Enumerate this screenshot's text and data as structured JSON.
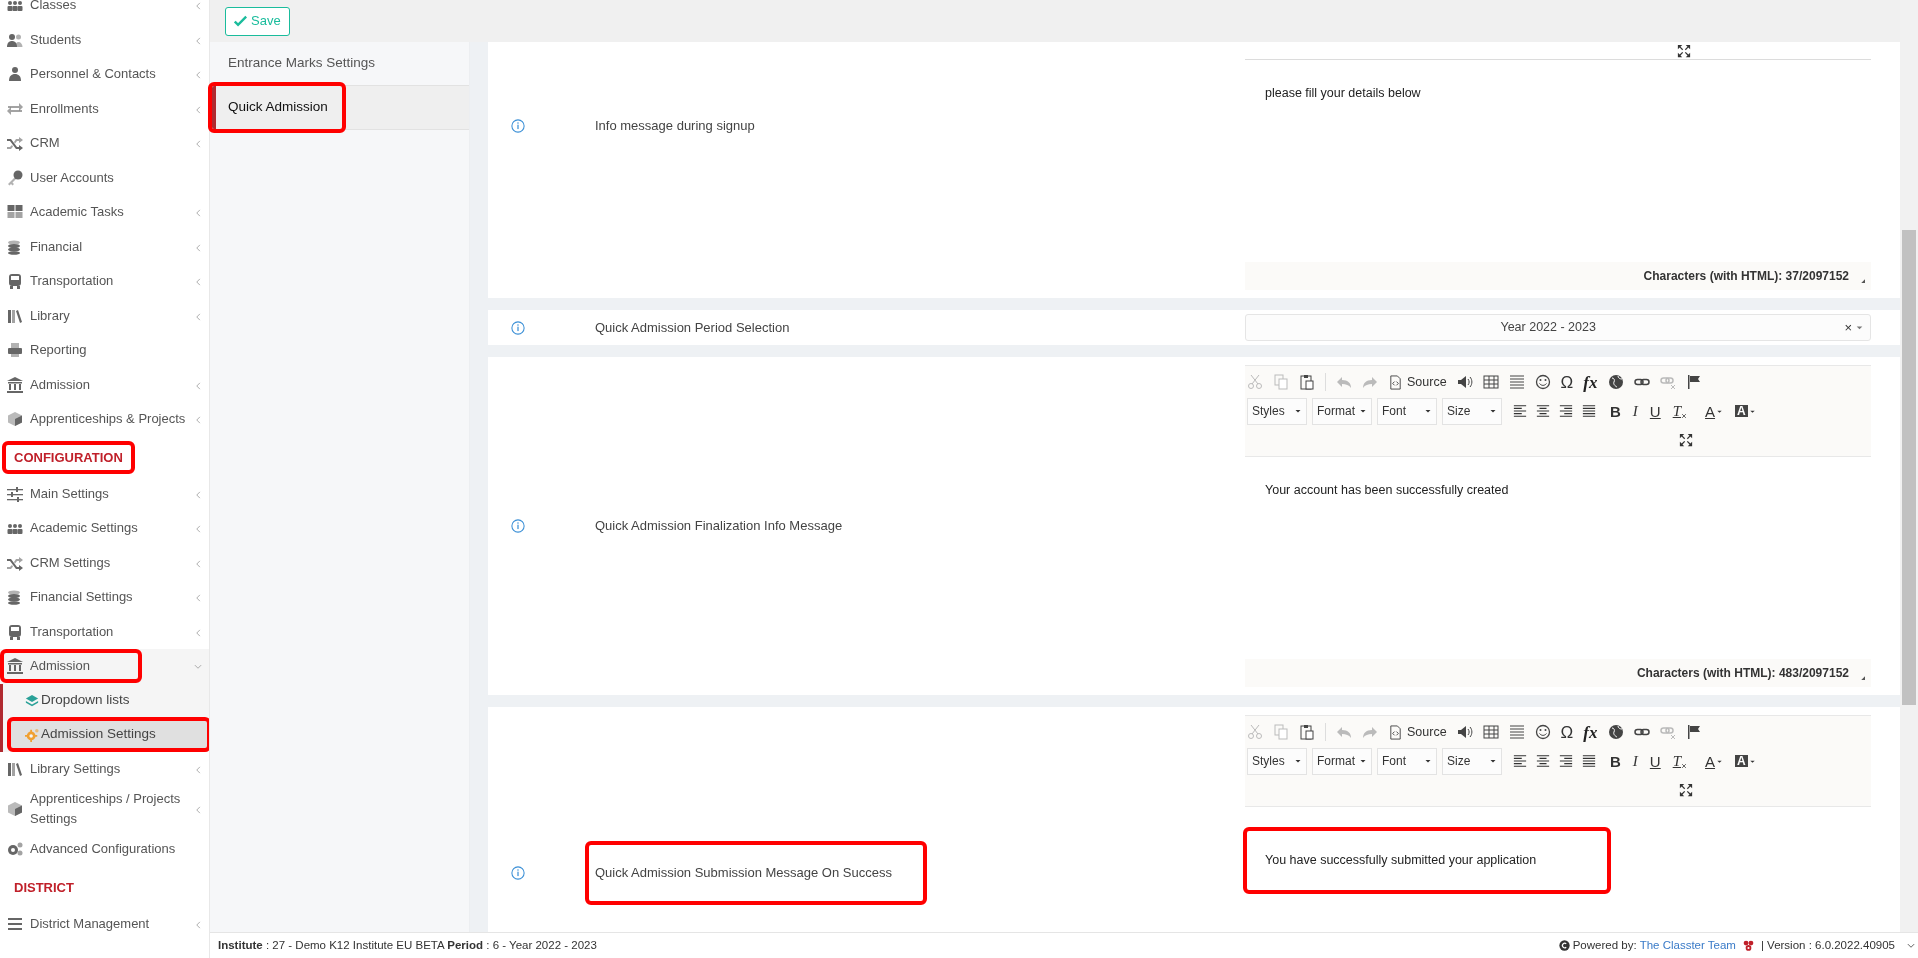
{
  "toolbar": {
    "save": "Save"
  },
  "sidebar": {
    "sections": [
      {
        "items": [
          {
            "label": "Classes",
            "submenu": true,
            "expanded": false,
            "selected": false,
            "highlighted": false
          },
          {
            "label": "Students",
            "submenu": true,
            "expanded": false,
            "selected": false,
            "highlighted": false
          },
          {
            "label": "Personnel & Contacts",
            "submenu": true,
            "expanded": false,
            "selected": false,
            "highlighted": false
          },
          {
            "label": "Enrollments",
            "submenu": true,
            "expanded": false,
            "selected": false,
            "highlighted": false
          },
          {
            "label": "CRM",
            "submenu": true,
            "expanded": false,
            "selected": false,
            "highlighted": false
          },
          {
            "label": "User Accounts",
            "submenu": false,
            "selected": false,
            "highlighted": false
          },
          {
            "label": "Academic Tasks",
            "submenu": true,
            "expanded": false,
            "selected": false,
            "highlighted": false
          },
          {
            "label": "Financial",
            "submenu": true,
            "expanded": false,
            "selected": false,
            "highlighted": false
          },
          {
            "label": "Transportation",
            "submenu": true,
            "expanded": false,
            "selected": false,
            "highlighted": false
          },
          {
            "label": "Library",
            "submenu": true,
            "expanded": false,
            "selected": false,
            "highlighted": false
          },
          {
            "label": "Reporting",
            "submenu": false,
            "selected": false,
            "highlighted": false
          },
          {
            "label": "Admission",
            "submenu": true,
            "expanded": false,
            "selected": false,
            "highlighted": false
          },
          {
            "label": "Apprenticeships & Projects",
            "submenu": true,
            "expanded": false,
            "selected": false,
            "highlighted": false
          }
        ]
      },
      {
        "heading": "CONFIGURATION",
        "heading_highlighted": true,
        "items": [
          {
            "label": "Main Settings",
            "submenu": true,
            "expanded": false,
            "selected": false,
            "highlighted": false
          },
          {
            "label": "Academic Settings",
            "submenu": true,
            "expanded": false,
            "selected": false,
            "highlighted": false
          },
          {
            "label": "CRM Settings",
            "submenu": true,
            "expanded": false,
            "selected": false,
            "highlighted": false
          },
          {
            "label": "Financial Settings",
            "submenu": true,
            "expanded": false,
            "selected": false,
            "highlighted": false
          },
          {
            "label": "Transportation",
            "submenu": true,
            "expanded": false,
            "selected": false,
            "highlighted": false
          },
          {
            "label": "Admission",
            "submenu": true,
            "expanded": true,
            "selected": false,
            "highlighted": true,
            "children": [
              {
                "label": "Dropdown lists",
                "selected": false,
                "highlighted": false
              },
              {
                "label": "Admission Settings",
                "selected": true,
                "highlighted": true
              }
            ]
          },
          {
            "label": "Library Settings",
            "submenu": true,
            "expanded": false,
            "selected": false,
            "highlighted": false
          },
          {
            "label": "Apprenticeships / Projects Settings",
            "submenu": true,
            "expanded": false,
            "selected": false,
            "highlighted": false
          },
          {
            "label": "Advanced Configurations",
            "submenu": false,
            "selected": false,
            "highlighted": false
          }
        ]
      },
      {
        "heading": "DISTRICT",
        "heading_highlighted": false,
        "items": [
          {
            "label": "District Management",
            "submenu": true,
            "expanded": false,
            "selected": false,
            "highlighted": false
          }
        ]
      }
    ]
  },
  "settings_nav": [
    {
      "label": "Entrance Marks Settings",
      "selected": false,
      "highlighted": false
    },
    {
      "label": "Quick Admission",
      "selected": true,
      "highlighted": true
    }
  ],
  "settings": [
    {
      "label": "Info message during signup",
      "label_highlighted": false,
      "control": {
        "kind": "editor",
        "content": "please fill your details below",
        "content_highlighted": false,
        "counter": "Characters (with HTML): 37/2097152"
      }
    },
    {
      "label": "Quick Admission Period Selection",
      "label_highlighted": false,
      "control": {
        "kind": "select",
        "value": "Year 2022 - 2023",
        "clear": "×"
      }
    },
    {
      "label": "Quick Admission Finalization Info Message",
      "label_highlighted": false,
      "control": {
        "kind": "editor",
        "toolbar": {
          "source": "Source",
          "symbol": "Ω",
          "formula": "fx",
          "dropdowns": [
            "Styles",
            "Format",
            "Font",
            "Size"
          ],
          "marks": [
            "B",
            "I",
            "U",
            "T",
            "A",
            "A"
          ]
        },
        "content": "Your account has been successfully created",
        "content_highlighted": false,
        "counter": "Characters (with HTML): 483/2097152"
      }
    },
    {
      "label": "Quick Admission Submission Message On Success",
      "label_highlighted": true,
      "control": {
        "kind": "editor",
        "toolbar": {
          "source": "Source",
          "symbol": "Ω",
          "formula": "fx",
          "dropdowns": [
            "Styles",
            "Format",
            "Font",
            "Size"
          ],
          "marks": [
            "B",
            "I",
            "U",
            "T",
            "A",
            "A"
          ]
        },
        "content": "You have successfully submitted your application",
        "content_highlighted": true
      }
    }
  ],
  "footer": {
    "info": "**Institute** : 27 - Demo K12 Institute EU BETA **Period** : 6 - Year 2022 - 2023",
    "powered": "Powered by:",
    "team_link": "The Classter Team",
    "version": "| Version : 6.0.2022.40905"
  }
}
